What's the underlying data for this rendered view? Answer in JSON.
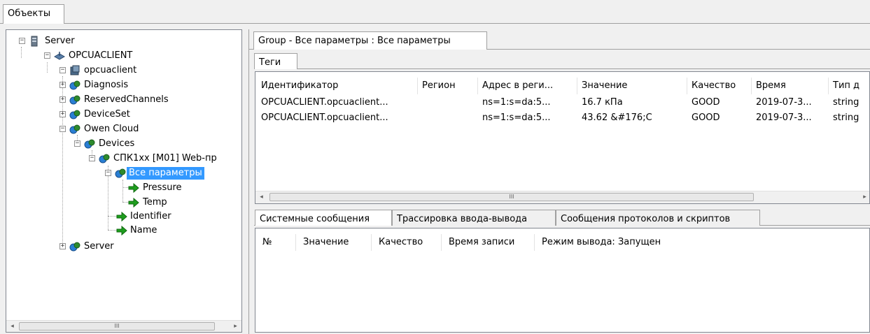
{
  "top_tab": {
    "label": "Объекты"
  },
  "tree": {
    "nodes": [
      {
        "label": "Server",
        "icon": "server-icon"
      },
      {
        "label": "OPCUACLIENT",
        "icon": "client-icon"
      },
      {
        "label": "opcuaclient",
        "icon": "device-icon"
      },
      {
        "label": "Diagnosis",
        "icon": "folder-node-icon"
      },
      {
        "label": "ReservedChannels",
        "icon": "folder-node-icon"
      },
      {
        "label": "DeviceSet",
        "icon": "folder-node-icon"
      },
      {
        "label": "Owen Cloud",
        "icon": "folder-node-icon"
      },
      {
        "label": "Devices",
        "icon": "folder-node-icon"
      },
      {
        "label": "СПК1хх [М01] Web-пр",
        "icon": "folder-node-icon"
      },
      {
        "label": "Все параметры",
        "icon": "folder-node-icon"
      },
      {
        "label": "Pressure",
        "icon": "tag-arrow-icon"
      },
      {
        "label": "Temp",
        "icon": "tag-arrow-icon"
      },
      {
        "label": "Identifier",
        "icon": "tag-arrow-icon"
      },
      {
        "label": "Name",
        "icon": "tag-arrow-icon"
      },
      {
        "label": "Server",
        "icon": "folder-node-icon"
      }
    ],
    "scroll_glyph": "III"
  },
  "group_tab": {
    "label": "Group - Все параметры : Все параметры"
  },
  "tags_tab": {
    "label": "Теги"
  },
  "tags_table": {
    "columns": [
      "Идентификатор",
      "Регион",
      "Адрес в реги...",
      "Значение",
      "Качество",
      "Время",
      "Тип д"
    ],
    "rows": [
      [
        "OPCUACLIENT.opcuaclient...",
        "",
        "ns=1:s=da:5...",
        "16.7 кПа",
        "GOOD",
        "2019-07-3...",
        "string"
      ],
      [
        "OPCUACLIENT.opcuaclient...",
        "",
        "ns=1:s=da:5...",
        "43.62 &#176;C",
        "GOOD",
        "2019-07-3...",
        "string"
      ]
    ],
    "scroll_glyph": "III"
  },
  "bottom_tabs": [
    "Системные сообщения",
    "Трассировка ввода-вывода",
    "Сообщения протоколов и скриптов"
  ],
  "log_table": {
    "columns": [
      "№",
      "Значение",
      "Качество",
      "Время записи",
      "Режим вывода: Запущен"
    ]
  },
  "colors": {
    "selection": "#3399ff",
    "icon_blue": "#2a7fd4",
    "icon_green": "#2e8b2e",
    "tag_arrow": "#1e9e1e"
  }
}
